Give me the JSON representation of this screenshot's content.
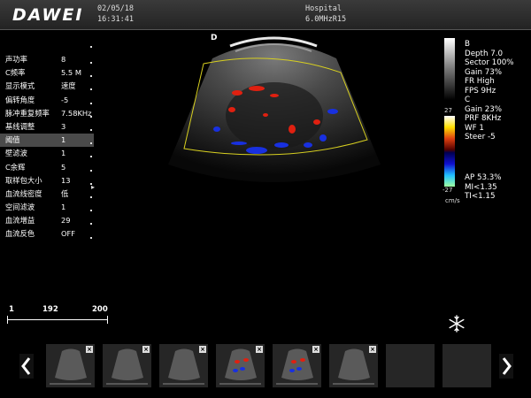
{
  "header": {
    "brand": "DAWEI",
    "date": "02/05/18",
    "time": "16:31:41",
    "hospital": "Hospital",
    "probe": "6.0MHzR15"
  },
  "image": {
    "orientation_marker": "D"
  },
  "params": [
    {
      "label": "声功率",
      "value": "8"
    },
    {
      "label": "C频率",
      "value": "5.5 M"
    },
    {
      "label": "显示模式",
      "value": "速度"
    },
    {
      "label": "偏转角度",
      "value": "-5"
    },
    {
      "label": "脉冲重复频率",
      "value": "7.58KHz"
    },
    {
      "label": "基线调整",
      "value": "3"
    },
    {
      "label": "阈值",
      "value": "1",
      "selected": true
    },
    {
      "label": "壁滤波",
      "value": "1"
    },
    {
      "label": "C余辉",
      "value": "5"
    },
    {
      "label": "取样包大小",
      "value": "13"
    },
    {
      "label": "血流线密度",
      "value": "低"
    },
    {
      "label": "空间滤波",
      "value": "1"
    },
    {
      "label": "血流增益",
      "value": "29"
    },
    {
      "label": "血流反色",
      "value": "OFF"
    }
  ],
  "sidebar": {
    "b_label": "B",
    "depth": "Depth 7.0",
    "sector": "Sector 100%",
    "gain_b": "Gain 73%",
    "fr": "FR High",
    "fps": "FPS 9Hz",
    "c_label": "C",
    "gain_c": "Gain 23%",
    "prf": "PRF 8KHz",
    "wf": "WF 1",
    "steer": "Steer -5",
    "ap": "AP 53.3%",
    "mi": "MI<1.35",
    "ti": "TI<1.15",
    "scale_top": "27",
    "scale_bottom": "-27",
    "scale_unit": "cm/s"
  },
  "scale": {
    "left": "1",
    "mid": "192",
    "right": "200"
  },
  "thumbnails": {
    "close_glyph": "×",
    "items": [
      {
        "kind": "bmode"
      },
      {
        "kind": "bmode"
      },
      {
        "kind": "bmode"
      },
      {
        "kind": "color"
      },
      {
        "kind": "color"
      },
      {
        "kind": "bmode"
      },
      {
        "kind": "empty"
      },
      {
        "kind": "empty"
      }
    ]
  },
  "colors": {
    "accent_roi": "#d8d020",
    "selected_row": "#4a4a4a",
    "flow_red": "#e02010",
    "flow_blue": "#1830e0"
  }
}
